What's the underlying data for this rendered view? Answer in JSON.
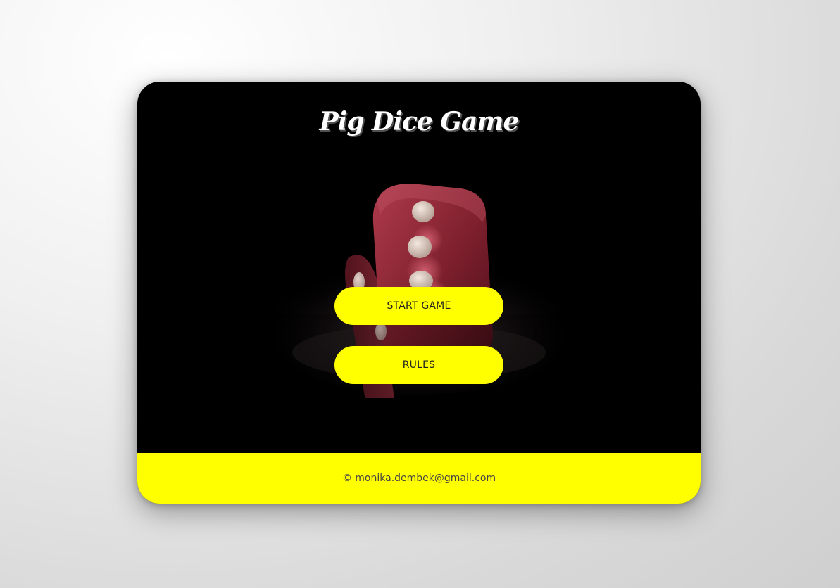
{
  "app": {
    "title": "Pig Dice Game"
  },
  "menu": {
    "start_label": "START GAME",
    "rules_label": "RULES"
  },
  "footer": {
    "text": "© monika.dembek@gmail.com"
  },
  "colors": {
    "accent": "#ffff00",
    "background": "#000000",
    "dice": "#8a2230"
  },
  "icons": {
    "hero_image": "dice-icon"
  }
}
